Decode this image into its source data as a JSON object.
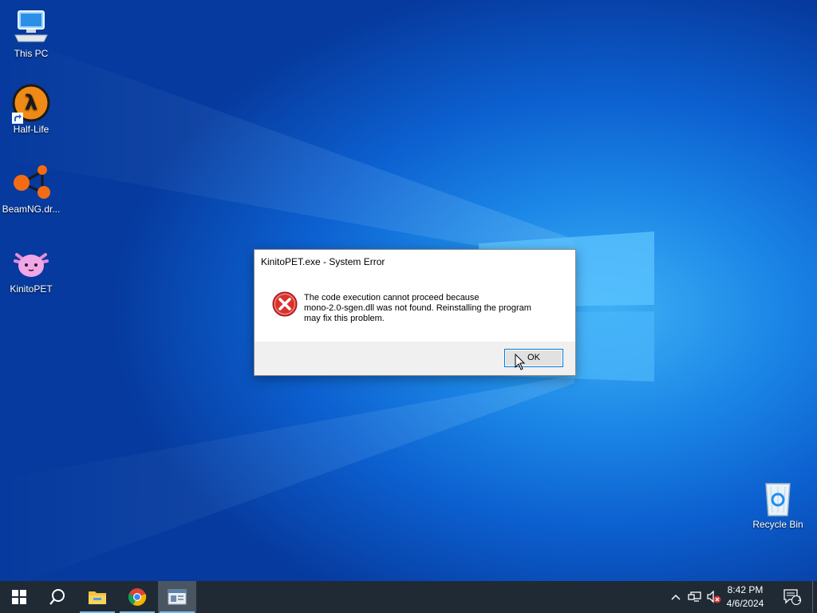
{
  "desktop": {
    "icons": [
      {
        "label": "This PC",
        "icon": "computer-icon"
      },
      {
        "label": "Half-Life",
        "icon": "half-life-icon"
      },
      {
        "label": "BeamNG.dr...",
        "icon": "beamng-icon"
      },
      {
        "label": "KinitoPET",
        "icon": "kinitopet-icon"
      },
      {
        "label": "Recycle Bin",
        "icon": "recycle-bin-icon"
      }
    ]
  },
  "dialog": {
    "title": "KinitoPET.exe - System Error",
    "message_line1": "The code execution cannot proceed because",
    "message_line2": "mono-2.0-sgen.dll was not found. Reinstalling the program",
    "message_line3": "may fix this problem.",
    "ok_label": "OK",
    "icon": "error-icon"
  },
  "taskbar": {
    "buttons": [
      "windows-start-icon",
      "search-icon",
      "file-explorer-icon",
      "chrome-icon",
      "kinitopet-app-icon"
    ],
    "active": "kinitopet-app-icon",
    "tray_icons": [
      "chevron-up-icon",
      "network-icon",
      "volume-muted-icon"
    ],
    "time": "8:42 PM",
    "date": "4/6/2024",
    "notification_count": "1"
  },
  "colors": {
    "accent": "#0078d7",
    "taskbar": "#1f2a35",
    "error_red": "#d9322c"
  }
}
